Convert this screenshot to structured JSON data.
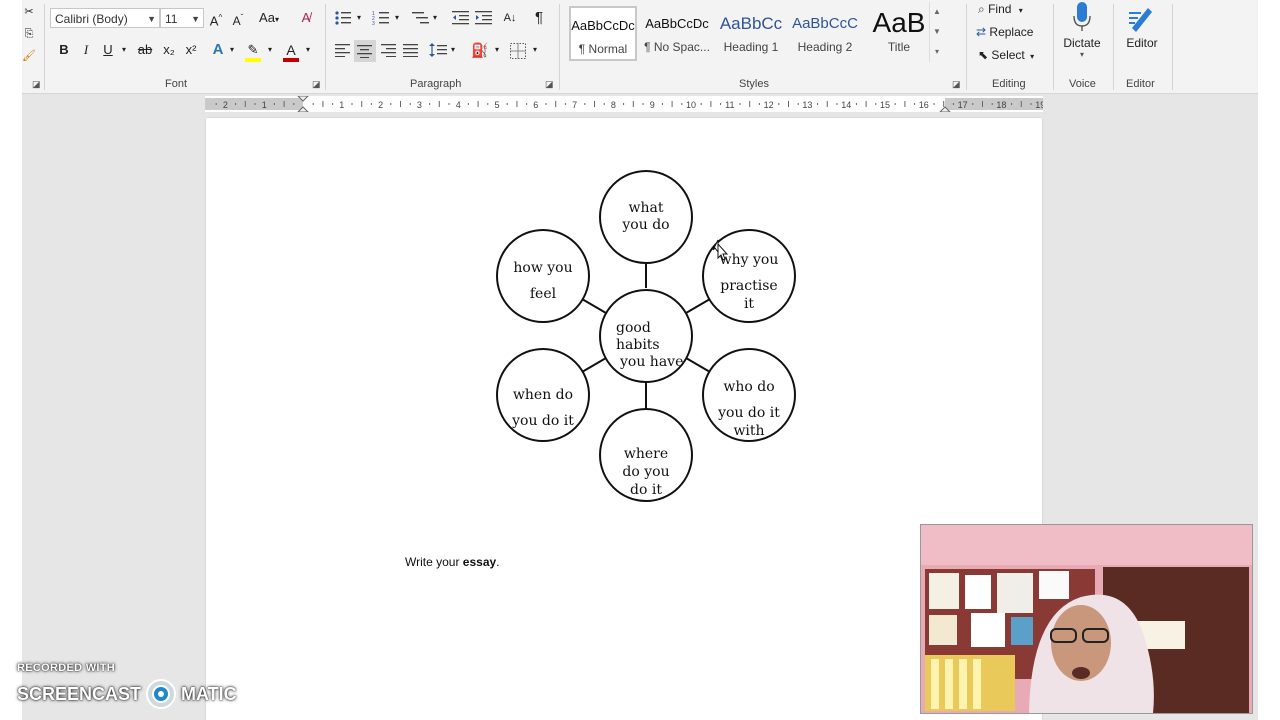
{
  "ribbon": {
    "font": {
      "label": "Font",
      "font_name": "Calibri (Body)",
      "font_size": "11",
      "change_case": "Aa",
      "bold": "B",
      "italic": "I",
      "underline": "U",
      "strike": "ab",
      "subscript": "x₂",
      "superscript": "x²"
    },
    "paragraph": {
      "label": "Paragraph",
      "pilcrow": "¶"
    },
    "styles": {
      "label": "Styles",
      "items": [
        {
          "preview": "AaBbCcDc",
          "name": "¶ Normal"
        },
        {
          "preview": "AaBbCcDc",
          "name": "¶ No Spac..."
        },
        {
          "preview": "AaBbCc",
          "name": "Heading 1"
        },
        {
          "preview": "AaBbCcC",
          "name": "Heading 2"
        },
        {
          "preview": "AaB",
          "name": "Title"
        }
      ]
    },
    "editing": {
      "label": "Editing",
      "find": "Find",
      "replace": "Replace",
      "select": "Select"
    },
    "voice": {
      "label": "Voice",
      "dictate": "Dictate"
    },
    "editor": {
      "label": "Editor",
      "editor": "Editor"
    }
  },
  "ruler": {
    "numbers": [
      "2",
      "1",
      "1",
      "2",
      "3",
      "4",
      "5",
      "6",
      "7",
      "8",
      "9",
      "10",
      "11",
      "12",
      "13",
      "14",
      "15",
      "16",
      "17",
      "18",
      "19"
    ]
  },
  "diagram": {
    "center": [
      "good",
      "habits",
      "you have"
    ],
    "bubbles": [
      {
        "lines": [
          "what",
          "you do"
        ]
      },
      {
        "lines": [
          "why you",
          "practise",
          "it"
        ]
      },
      {
        "lines": [
          "who do",
          "you do it",
          "with"
        ]
      },
      {
        "lines": [
          "where",
          "do you",
          "do it"
        ]
      },
      {
        "lines": [
          "when do",
          "you do it"
        ]
      },
      {
        "lines": [
          "how you",
          "feel"
        ]
      }
    ]
  },
  "document": {
    "essay_prefix": "Write your ",
    "essay_bold": "essay",
    "essay_suffix": "."
  },
  "watermark": {
    "line1": "RECORDED WITH",
    "line2a": "SCREENCAST",
    "line2b": "MATIC"
  },
  "colors": {
    "font_color": "#c00000",
    "highlight": "#ffff00",
    "accent": "#2b579a"
  }
}
